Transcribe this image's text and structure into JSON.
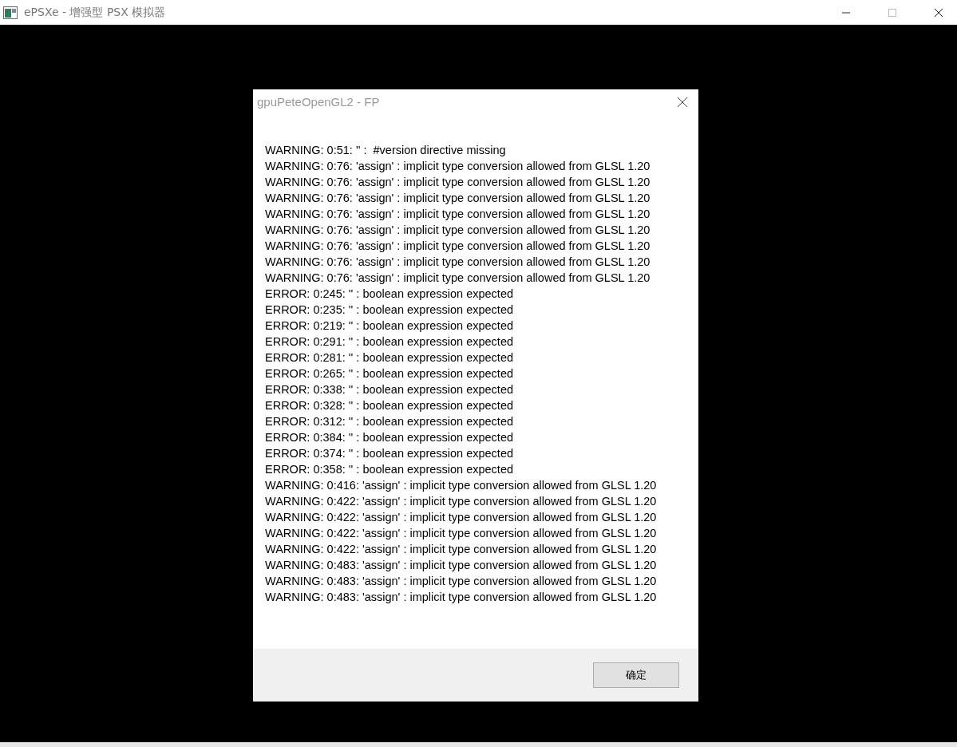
{
  "window": {
    "title": "ePSXe - 增强型 PSX 模拟器"
  },
  "dialog": {
    "title": "gpuPeteOpenGL2 - FP",
    "lines": [
      "WARNING: 0:51: '' :  #version directive missing",
      "WARNING: 0:76: 'assign' : implicit type conversion allowed from GLSL 1.20",
      "WARNING: 0:76: 'assign' : implicit type conversion allowed from GLSL 1.20",
      "WARNING: 0:76: 'assign' : implicit type conversion allowed from GLSL 1.20",
      "WARNING: 0:76: 'assign' : implicit type conversion allowed from GLSL 1.20",
      "WARNING: 0:76: 'assign' : implicit type conversion allowed from GLSL 1.20",
      "WARNING: 0:76: 'assign' : implicit type conversion allowed from GLSL 1.20",
      "WARNING: 0:76: 'assign' : implicit type conversion allowed from GLSL 1.20",
      "WARNING: 0:76: 'assign' : implicit type conversion allowed from GLSL 1.20",
      "ERROR: 0:245: '' : boolean expression expected",
      "ERROR: 0:235: '' : boolean expression expected",
      "ERROR: 0:219: '' : boolean expression expected",
      "ERROR: 0:291: '' : boolean expression expected",
      "ERROR: 0:281: '' : boolean expression expected",
      "ERROR: 0:265: '' : boolean expression expected",
      "ERROR: 0:338: '' : boolean expression expected",
      "ERROR: 0:328: '' : boolean expression expected",
      "ERROR: 0:312: '' : boolean expression expected",
      "ERROR: 0:384: '' : boolean expression expected",
      "ERROR: 0:374: '' : boolean expression expected",
      "ERROR: 0:358: '' : boolean expression expected",
      "WARNING: 0:416: 'assign' : implicit type conversion allowed from GLSL 1.20",
      "WARNING: 0:422: 'assign' : implicit type conversion allowed from GLSL 1.20",
      "WARNING: 0:422: 'assign' : implicit type conversion allowed from GLSL 1.20",
      "WARNING: 0:422: 'assign' : implicit type conversion allowed from GLSL 1.20",
      "WARNING: 0:422: 'assign' : implicit type conversion allowed from GLSL 1.20",
      "WARNING: 0:483: 'assign' : implicit type conversion allowed from GLSL 1.20",
      "WARNING: 0:483: 'assign' : implicit type conversion allowed from GLSL 1.20",
      "WARNING: 0:483: 'assign' : implicit type conversion allowed from GLSL 1.20"
    ],
    "ok_button": "确定"
  }
}
